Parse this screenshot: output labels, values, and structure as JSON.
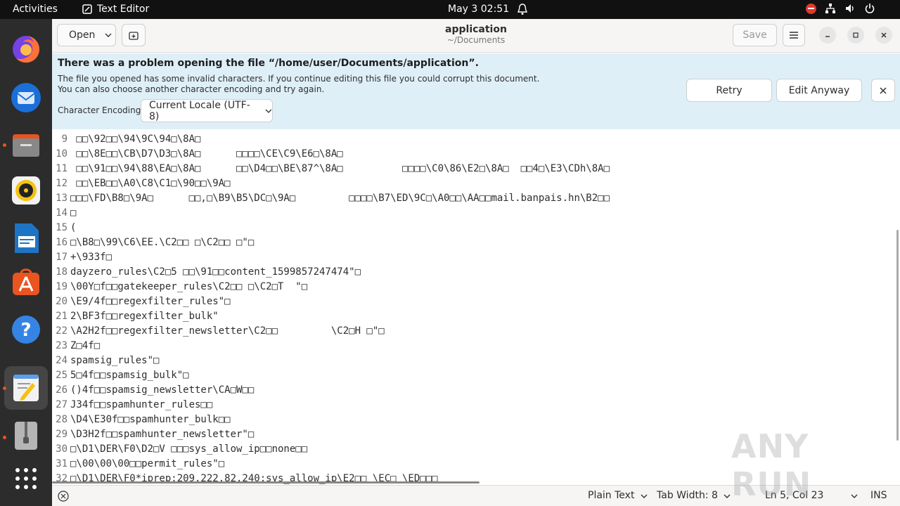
{
  "topbar": {
    "activities": "Activities",
    "app_name": "Text Editor",
    "clock": "May 3  02:51"
  },
  "dock": {
    "items": [
      "firefox-icon",
      "thunderbird-icon",
      "files-icon",
      "rhythmbox-icon",
      "libreoffice-writer-icon",
      "app-center-icon",
      "help-icon",
      "text-editor-icon",
      "archive-manager-icon",
      "show-apps-icon"
    ]
  },
  "header": {
    "open_label": "Open",
    "title": "application",
    "subtitle": "~/Documents",
    "save_label": "Save"
  },
  "infobar": {
    "heading": "There was a problem opening the file “/home/user/Documents/application”.",
    "message_line1": "The file you opened has some invalid characters. If you continue editing this file you could corrupt this document.",
    "message_line2": "You can also choose another character encoding and try again.",
    "encoding_label": "Character Encoding:",
    "encoding_value": "Current Locale (UTF-8)",
    "retry_label": "Retry",
    "edit_anyway_label": "Edit Anyway"
  },
  "editor": {
    "lines": [
      {
        "n": "9",
        "text": " □□\\92□□\\94\\9C\\94□\\8A□"
      },
      {
        "n": "10",
        "text": " □□\\8E□□\\CB\\D7\\D3□\\8A□      □□□□\\CE\\C9\\E6□\\8A□"
      },
      {
        "n": "11",
        "text": " □□\\91□□\\94\\88\\EA□\\8A□      □□\\D4□□\\BE\\87^\\8A□          □□□□\\C0\\86\\E2□\\8A□  □□4□\\E3\\CDh\\8A□"
      },
      {
        "n": "12",
        "text": " □□\\EB□□\\A0\\C8\\C1□\\90□□\\9A□"
      },
      {
        "n": "13",
        "text": "□□□\\FD\\B8□\\9A□      □□,□\\B9\\B5\\DC□\\9A□         □□□□\\B7\\ED\\9C□\\A0□□\\AA□□mail.banpais.hn\\B2□□"
      },
      {
        "n": "14",
        "text": "□"
      },
      {
        "n": "15",
        "text": "("
      },
      {
        "n": "16",
        "text": "□\\B8□\\99\\C6\\EE.\\C2□□ □\\C2□□ □\"□"
      },
      {
        "n": "17",
        "text": "+\\933f□"
      },
      {
        "n": "18",
        "text": "dayzero_rules\\C2□5 □□\\91□□content_1599857247474\"□"
      },
      {
        "n": "19",
        "text": "\\00Y□f□□gatekeeper_rules\\C2□□ □\\C2□T  \"□"
      },
      {
        "n": "20",
        "text": "\\E9/4f□□regexfilter_rules\"□"
      },
      {
        "n": "21",
        "text": "2\\BF3f□□regexfilter_bulk\""
      },
      {
        "n": "22",
        "text": "\\A2H2f□□regexfilter_newsletter\\C2□□         \\C2□H □\"□"
      },
      {
        "n": "23",
        "text": "Z□4f□"
      },
      {
        "n": "24",
        "text": "spamsig_rules\"□"
      },
      {
        "n": "25",
        "text": "5□4f□□spamsig_bulk\"□"
      },
      {
        "n": "26",
        "text": "()4f□□spamsig_newsletter\\CA□W□□"
      },
      {
        "n": "27",
        "text": "J34f□□spamhunter_rules□□"
      },
      {
        "n": "28",
        "text": "\\D4\\E30f□□spamhunter_bulk□□"
      },
      {
        "n": "29",
        "text": "\\D3H2f□□spamhunter_newsletter\"□"
      },
      {
        "n": "30",
        "text": "□\\D1\\DER\\F0\\D2□V □□□sys_allow_ip□□none□□"
      },
      {
        "n": "31",
        "text": "□\\00\\00\\00□□permit_rules\"□"
      },
      {
        "n": "32",
        "text": "□\\D1\\DER\\F0*iprep:209.222.82.240:sys_allow_ip\\E2□□ \\EC□ \\ED□□□"
      }
    ]
  },
  "statusbar": {
    "language": "Plain Text",
    "tab_width": "Tab Width: 8",
    "position": "Ln 5, Col 23",
    "mode": "INS"
  },
  "watermark": "ANY RUN"
}
